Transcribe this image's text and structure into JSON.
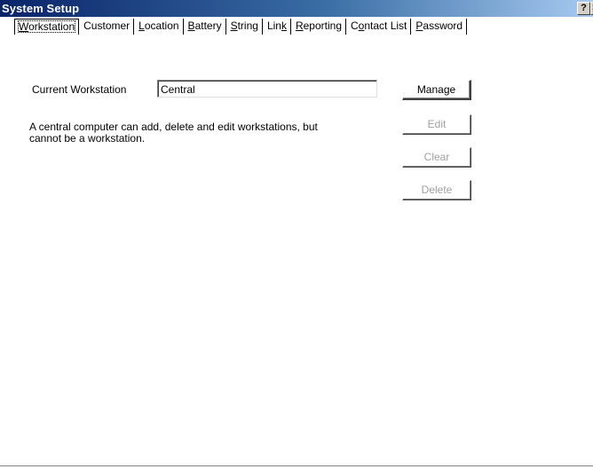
{
  "window": {
    "title": "System Setup",
    "help_button": "?",
    "close_button": "×"
  },
  "tabs": [
    {
      "label": "Workstation",
      "accel_index": 0,
      "active": true
    },
    {
      "label": "Customer",
      "active": false
    },
    {
      "label": "Location",
      "accel_index": 0,
      "active": false
    },
    {
      "label": "Battery",
      "accel_index": 0,
      "active": false
    },
    {
      "label": "String",
      "accel_index": 0,
      "active": false
    },
    {
      "label": "Link",
      "accel_index": 3,
      "active": false
    },
    {
      "label": "Reporting",
      "accel_index": 0,
      "active": false
    },
    {
      "label": "Contact List",
      "accel_index": 1,
      "active": false
    },
    {
      "label": "Password",
      "accel_index": 0,
      "active": false
    }
  ],
  "workstation": {
    "current_label": "Current Workstation",
    "current_value": "Central",
    "description_line1": "A central computer can add, delete and edit workstations, but",
    "description_line2": "cannot be a workstation.",
    "buttons": {
      "manage": "Manage",
      "edit": "Edit",
      "clear": "Clear",
      "delete": "Delete"
    }
  },
  "colors": {
    "titlebar_start": "#0a246a",
    "titlebar_end": "#a6caf0",
    "disabled_text": "#a0a0a0"
  }
}
